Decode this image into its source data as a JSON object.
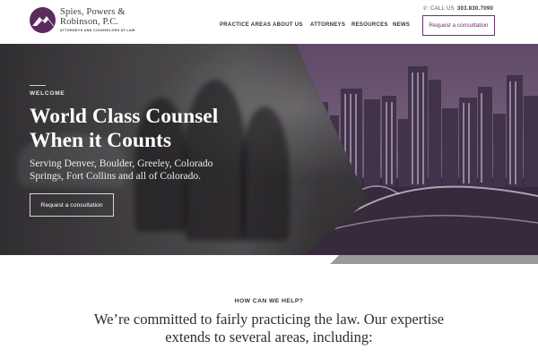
{
  "header": {
    "logo": {
      "line1": "Spies, Powers &",
      "line2": "Robinson, P.C.",
      "tagline": "ATTORNEYS AND COUNSELORS AT LAW",
      "icon": "mountain-logo-icon",
      "brand_color": "#5b2a5f"
    },
    "phone": {
      "icon": "phone-icon",
      "label": "CALL US",
      "number": "303.830.7090"
    },
    "nav": {
      "items": [
        {
          "label": "PRACTICE AREAS"
        },
        {
          "label": "ABOUT US"
        },
        {
          "label": "ATTORNEYS"
        },
        {
          "label": "RESOURCES"
        },
        {
          "label": "NEWS"
        }
      ],
      "cta_label": "Request a consultation"
    }
  },
  "hero": {
    "eyebrow": "WELCOME",
    "title_line1": "World Class Counsel",
    "title_line2": "When it Counts",
    "subtitle": "Serving Denver, Boulder, Greeley, Colorado Springs, Fort Collins and all of Colorado.",
    "button_label": "Request a consultation",
    "overlay_color": "#6a4f72"
  },
  "help": {
    "eyebrow": "HOW CAN WE HELP?",
    "heading": "We’re committed to fairly practicing the law. Our expertise extends to several areas, including:"
  },
  "colors": {
    "accent": "#6b3070",
    "strip": "#9a9a9a"
  }
}
